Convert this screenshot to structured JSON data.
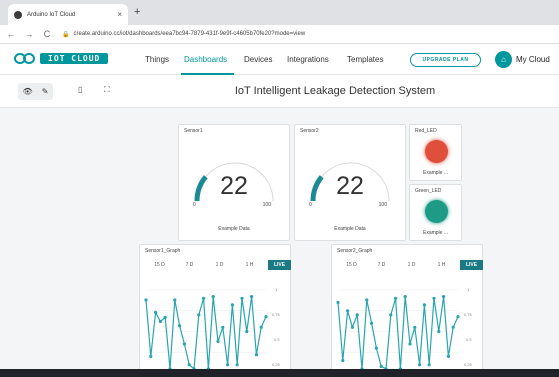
{
  "browser": {
    "tab_title": "Arduino IoT Cloud",
    "tab_close": "×",
    "new_tab": "+",
    "back": "←",
    "forward": "→",
    "reload": "C",
    "url": "create.arduino.cc/iot/dashboards/eea7bc94-7879-431f-9e9f-c4605b70fe20?mode=view"
  },
  "header": {
    "logo_text": "IOT CLOUD",
    "nav": [
      "Things",
      "Dashboards",
      "Devices",
      "Integrations",
      "Templates"
    ],
    "active_nav": "Dashboards",
    "upgrade_label": "UPGRADE PLAN",
    "cloud_label": "My Cloud"
  },
  "toolbar": {
    "title": "IoT Intelligent Leakage Detection System"
  },
  "widgets": {
    "sensor1": {
      "title": "Sensor1",
      "value": "22",
      "min": "0",
      "max": "100",
      "fraction": 0.22,
      "footer": "Example Data"
    },
    "sensor2": {
      "title": "Sensor2",
      "value": "22",
      "min": "0",
      "max": "100",
      "fraction": 0.22,
      "footer": "Example Data"
    },
    "red_led": {
      "title": "Red_LED",
      "footer": "Example ...",
      "color": "#e04f3c"
    },
    "green_led": {
      "title": "Green_LED",
      "footer": "Example ...",
      "color": "#1e9b86"
    },
    "graph1": {
      "title": "Sensor1_Graph",
      "ranges": [
        "15 D",
        "7 D",
        "1 D",
        "1 H",
        "LIVE"
      ],
      "yticks": [
        "1",
        "0.75",
        "0.5",
        "0.25"
      ]
    },
    "graph2": {
      "title": "Sensor2_Graph",
      "ranges": [
        "15 D",
        "7 D",
        "1 D",
        "1 H",
        "LIVE"
      ],
      "yticks": [
        "1",
        "0.75",
        "0.5",
        "0.25"
      ]
    }
  },
  "colors": {
    "accent": "#00979d",
    "gauge_arc": "#1b8a96",
    "line": "#2aa5b0"
  },
  "chart_data": [
    {
      "type": "line",
      "name": "Sensor1_Graph",
      "ylim": [
        0,
        1
      ],
      "values": [
        0.88,
        0.2,
        0.73,
        0.62,
        0.67,
        0.05,
        0.88,
        0.57,
        0.35,
        0.1,
        0.05,
        0.7,
        0.9,
        0.05,
        0.92,
        0.38,
        0.55,
        0.1,
        0.82,
        0.1,
        0.9,
        0.5,
        0.92,
        0.22,
        0.55,
        0.68
      ]
    },
    {
      "type": "line",
      "name": "Sensor2_Graph",
      "ylim": [
        0,
        1
      ],
      "values": [
        0.85,
        0.15,
        0.75,
        0.55,
        0.7,
        0.05,
        0.88,
        0.6,
        0.3,
        0.08,
        0.05,
        0.7,
        0.9,
        0.05,
        0.92,
        0.35,
        0.55,
        0.1,
        0.82,
        0.1,
        0.9,
        0.5,
        0.92,
        0.2,
        0.55,
        0.68
      ]
    }
  ]
}
